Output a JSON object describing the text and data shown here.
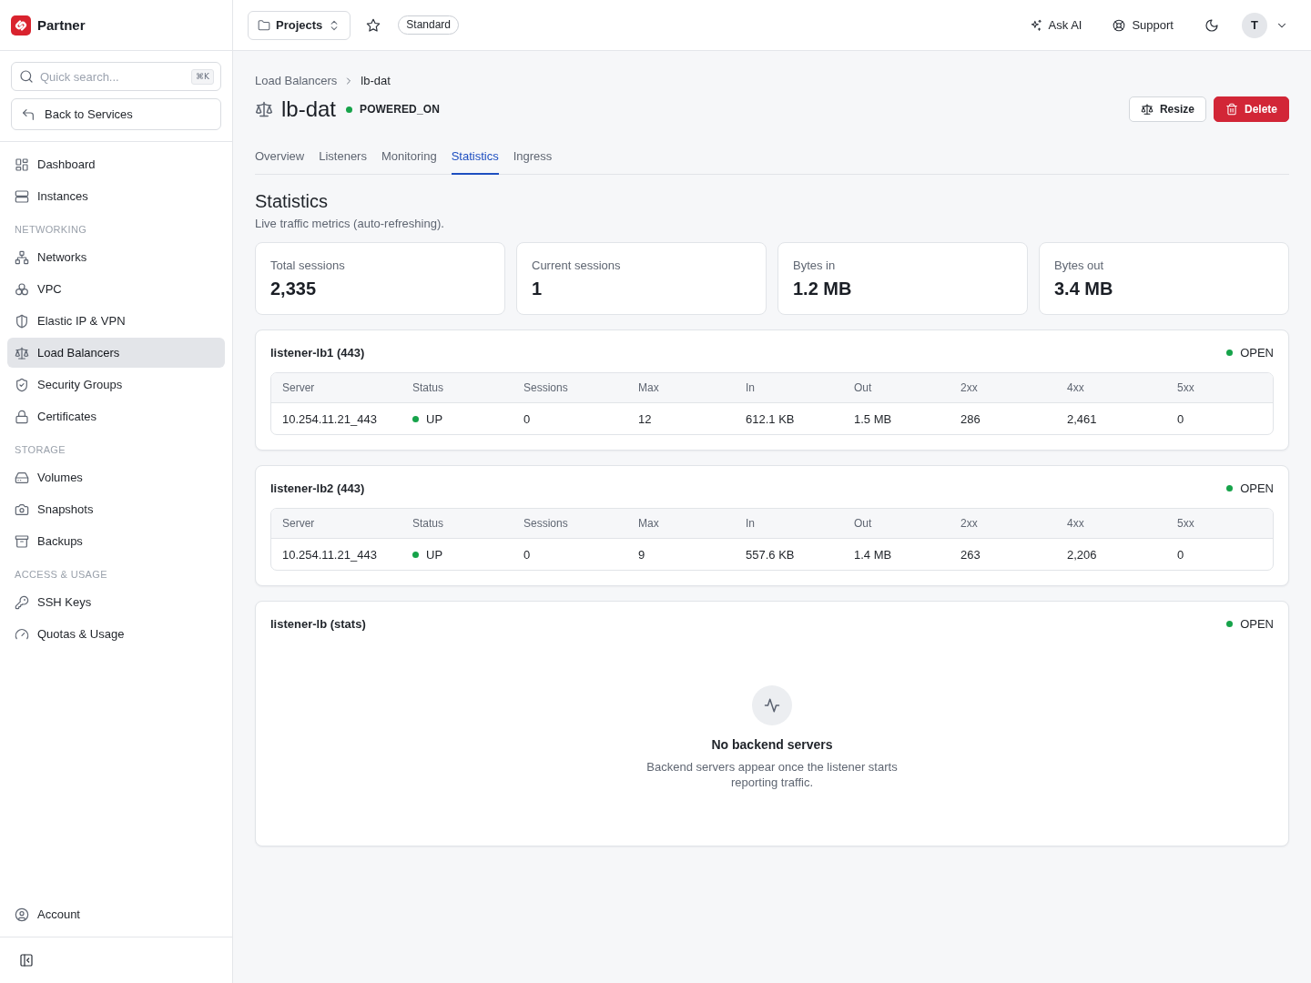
{
  "sidebar": {
    "brand": "Partner",
    "search": {
      "placeholder": "Quick search...",
      "shortcut": "⌘K"
    },
    "back_button": "Back to Services",
    "sections": [
      {
        "items": [
          {
            "label": "Dashboard",
            "selected": false
          },
          {
            "label": "Instances",
            "selected": false
          }
        ]
      },
      {
        "heading": "NETWORKING",
        "items": [
          {
            "label": "Networks",
            "selected": false
          },
          {
            "label": "VPC",
            "selected": false
          },
          {
            "label": "Elastic IP & VPN",
            "selected": false
          },
          {
            "label": "Load Balancers",
            "selected": true
          },
          {
            "label": "Security Groups",
            "selected": false
          },
          {
            "label": "Certificates",
            "selected": false
          }
        ]
      },
      {
        "heading": "STORAGE",
        "items": [
          {
            "label": "Volumes",
            "selected": false
          },
          {
            "label": "Snapshots",
            "selected": false
          },
          {
            "label": "Backups",
            "selected": false
          }
        ]
      },
      {
        "heading": "ACCESS & USAGE",
        "items": [
          {
            "label": "SSH Keys",
            "selected": false
          },
          {
            "label": "Quotas & Usage",
            "selected": false
          }
        ]
      }
    ],
    "account": "Account"
  },
  "topbar": {
    "project_selector": "Projects",
    "plan_badge": "Standard",
    "links": [
      "Ask AI",
      "Support"
    ],
    "avatar": "T"
  },
  "breadcrumb": [
    "Load Balancers",
    "lb-dat"
  ],
  "header": {
    "title": "lb-dat",
    "status": "POWERED_ON",
    "buttons": [
      {
        "label": "Resize",
        "kind": "secondary"
      },
      {
        "label": "Delete",
        "kind": "danger"
      }
    ]
  },
  "tabs": [
    {
      "label": "Overview",
      "selected": false
    },
    {
      "label": "Listeners",
      "selected": false
    },
    {
      "label": "Monitoring",
      "selected": false
    },
    {
      "label": "Statistics",
      "selected": true
    },
    {
      "label": "Ingress",
      "selected": false
    }
  ],
  "statistics": {
    "title": "Statistics",
    "subtitle": "Live traffic metrics (auto-refreshing).",
    "cards": [
      {
        "label": "Total sessions",
        "value": "2,335"
      },
      {
        "label": "Current sessions",
        "value": "1"
      },
      {
        "label": "Bytes in",
        "value": "1.2 MB"
      },
      {
        "label": "Bytes out",
        "value": "3.4 MB"
      }
    ]
  },
  "listeners": [
    {
      "name": "listener-lb1 (443)",
      "status": "OPEN",
      "columns": [
        {
          "label": "Server",
          "kind": "text"
        },
        {
          "label": "Status",
          "kind": "status"
        },
        {
          "label": "Sessions",
          "kind": "text"
        },
        {
          "label": "Max",
          "kind": "text"
        },
        {
          "label": "In",
          "kind": "text"
        },
        {
          "label": "Out",
          "kind": "text"
        },
        {
          "label": "2xx",
          "kind": "text"
        },
        {
          "label": "4xx",
          "kind": "text"
        },
        {
          "label": "5xx",
          "kind": "text"
        }
      ],
      "rows": [
        {
          "cells": [
            "10.254.11.21_443",
            "UP",
            "0",
            "12",
            "612.1 KB",
            "1.5 MB",
            "286",
            "2,461",
            "0"
          ]
        }
      ]
    },
    {
      "name": "listener-lb2 (443)",
      "status": "OPEN",
      "columns": [
        {
          "label": "Server",
          "kind": "text"
        },
        {
          "label": "Status",
          "kind": "status"
        },
        {
          "label": "Sessions",
          "kind": "text"
        },
        {
          "label": "Max",
          "kind": "text"
        },
        {
          "label": "In",
          "kind": "text"
        },
        {
          "label": "Out",
          "kind": "text"
        },
        {
          "label": "2xx",
          "kind": "text"
        },
        {
          "label": "4xx",
          "kind": "text"
        },
        {
          "label": "5xx",
          "kind": "text"
        }
      ],
      "rows": [
        {
          "cells": [
            "10.254.11.21_443",
            "UP",
            "0",
            "9",
            "557.6 KB",
            "1.4 MB",
            "263",
            "2,206",
            "0"
          ]
        }
      ]
    },
    {
      "name": "listener-lb (stats)",
      "status": "OPEN",
      "empty_state": {
        "title": "No backend servers",
        "text": "Backend servers appear once the listener starts reporting traffic."
      }
    }
  ]
}
